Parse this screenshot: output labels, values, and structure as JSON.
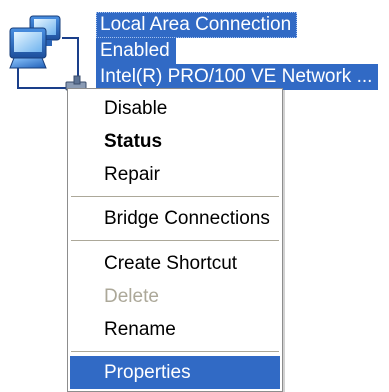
{
  "connection": {
    "name": "Local Area Connection",
    "status": "Enabled",
    "device": "Intel(R) PRO/100 VE Network ...",
    "icon": "network-connection-icon"
  },
  "context_menu": {
    "items": [
      {
        "label": "Disable",
        "style": "normal"
      },
      {
        "label": "Status",
        "style": "bold"
      },
      {
        "label": "Repair",
        "style": "normal"
      },
      {
        "label": "Bridge Connections",
        "style": "normal"
      },
      {
        "label": "Create Shortcut",
        "style": "normal"
      },
      {
        "label": "Delete",
        "style": "disabled"
      },
      {
        "label": "Rename",
        "style": "normal"
      },
      {
        "label": "Properties",
        "style": "selected"
      }
    ]
  },
  "colors": {
    "selection": "#316ac5",
    "disabled_text": "#aca899",
    "separator": "#aca899"
  }
}
